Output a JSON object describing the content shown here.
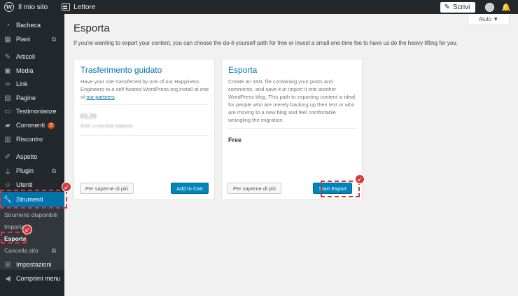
{
  "topbar": {
    "site_label": "Il mio sito",
    "reader_label": "Lettore",
    "write_label": "Scrivi"
  },
  "help": {
    "label": "Aiuto ▼"
  },
  "sidebar": {
    "items": [
      {
        "label": "Bacheca",
        "icon": "dashboard-icon"
      },
      {
        "label": "Piani",
        "icon": "plans-icon"
      },
      {
        "label": "Articoli",
        "icon": "pin-icon"
      },
      {
        "label": "Media",
        "icon": "media-icon"
      },
      {
        "label": "Link",
        "icon": "link-icon"
      },
      {
        "label": "Pagine",
        "icon": "pages-icon"
      },
      {
        "label": "Testimonianze",
        "icon": "testimonial-icon"
      },
      {
        "label": "Commenti",
        "icon": "comment-icon",
        "badge": "2"
      },
      {
        "label": "Riscontro",
        "icon": "feedback-icon"
      },
      {
        "label": "Aspetto",
        "icon": "brush-icon"
      },
      {
        "label": "Plugin",
        "icon": "plugin-icon"
      },
      {
        "label": "Utenti",
        "icon": "user-icon"
      },
      {
        "label": "Strumenti",
        "icon": "wrench-icon"
      },
      {
        "label": "Impostazioni",
        "icon": "settings-icon"
      },
      {
        "label": "Comprimi menu",
        "icon": "collapse-icon"
      }
    ],
    "submenu": [
      {
        "label": "Strumenti disponibili"
      },
      {
        "label": "Importa"
      },
      {
        "label": "Esporta"
      },
      {
        "label": "Cancella sito"
      }
    ]
  },
  "main": {
    "title": "Esporta",
    "intro": "If you're wanting to export your content, you can choose the do-it-yourself path for free or invest a small one-time fee to have us do the heavy lifting for you.",
    "cards": [
      {
        "title": "Trasferimento guidato",
        "desc": "Have your site transferred by one of our Happiness Engineers to a self-hosted WordPress.org install at one of ",
        "link": "our partners",
        "desc_end": ".",
        "price": "€3,29",
        "price_sub": "EUR, a one-time expense",
        "secondary": "Per saperne di più",
        "primary": "Add to Cart"
      },
      {
        "title": "Esporta",
        "desc": "Create an XML file containing your posts and comments, and save it or import it into another WordPress blog. This path to exporting content is ideal for people who are merely backing up their text or who are moving to a new blog and feel comfortable wrangling the migration.",
        "price": "Free",
        "secondary": "Per saperne di più",
        "primary": "Start Export"
      }
    ]
  },
  "colors": {
    "accent": "#0073aa",
    "highlight": "#d63638",
    "sidebar": "#23282d"
  }
}
